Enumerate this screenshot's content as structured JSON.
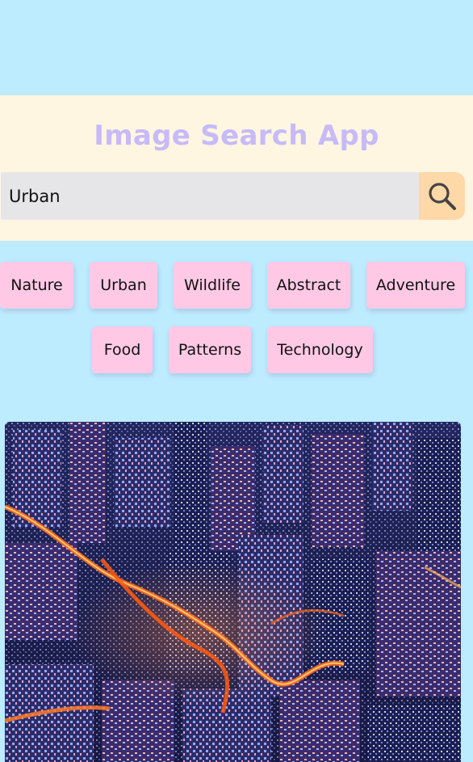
{
  "header": {
    "title": "Image Search App"
  },
  "search": {
    "value": "Urban",
    "button_icon": "search-icon"
  },
  "categories": [
    "Nature",
    "Urban",
    "Wildlife",
    "Abstract",
    "Adventure",
    "Food",
    "Patterns",
    "Technology"
  ],
  "colors": {
    "page_background": "#bdebff",
    "header_background": "#fff6e2",
    "title": "#c7baf7",
    "search_input": "#e6e6e8",
    "search_button": "#ffd8a8",
    "category_button": "#ffc9e6"
  },
  "results": [
    {
      "subject": "night-city-aerial"
    }
  ]
}
